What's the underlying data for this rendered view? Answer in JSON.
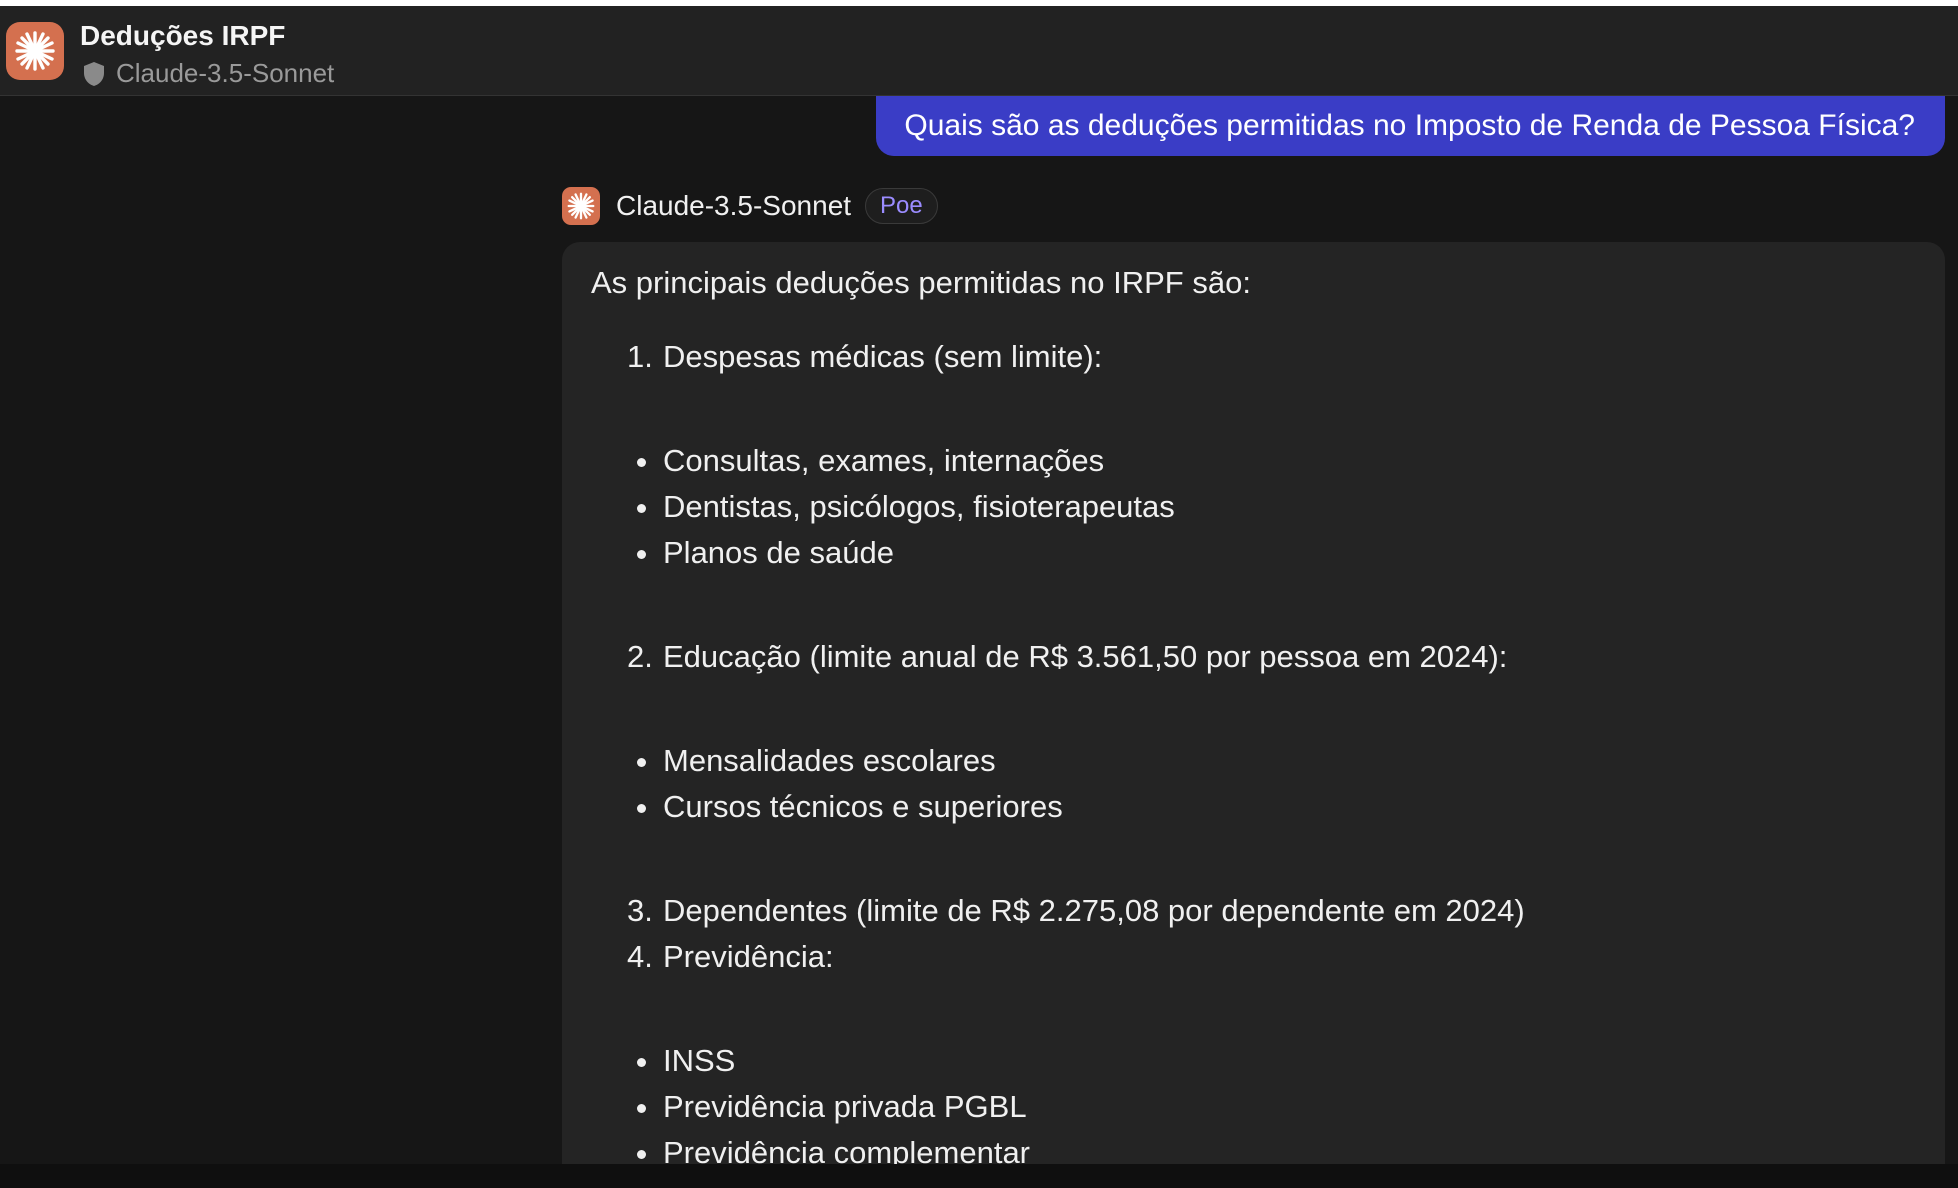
{
  "header": {
    "title": "Deduções IRPF",
    "bot_name": "Claude-3.5-Sonnet",
    "logo_icon": "claude-starburst-icon",
    "privacy_icon": "shield-icon"
  },
  "user_message": {
    "text": "Quais são as deduções permitidas no Imposto de Renda de Pessoa Física?"
  },
  "bot_message": {
    "author": "Claude-3.5-Sonnet",
    "badge": "Poe",
    "intro": "As principais deduções permitidas no IRPF são:",
    "sections": [
      {
        "number": "1.",
        "heading": "Despesas médicas (sem limite):",
        "bullets": [
          "Consultas, exames, internações",
          "Dentistas, psicólogos, fisioterapeutas",
          "Planos de saúde"
        ]
      },
      {
        "number": "2.",
        "heading": "Educação (limite anual de R$ 3.561,50 por pessoa em 2024):",
        "bullets": [
          "Mensalidades escolares",
          "Cursos técnicos e superiores"
        ]
      },
      {
        "number": "3.",
        "heading": "Dependentes (limite de R$ 2.275,08 por dependente em 2024)",
        "bullets": []
      },
      {
        "number": "4.",
        "heading": "Previdência:",
        "bullets": [
          "INSS",
          "Previdência privada PGBL",
          "Previdência complementar"
        ]
      }
    ]
  },
  "colors": {
    "accent_user_bubble": "#3a3dc6",
    "claude_orange": "#d4704f",
    "poe_badge_text": "#9b8cff"
  }
}
